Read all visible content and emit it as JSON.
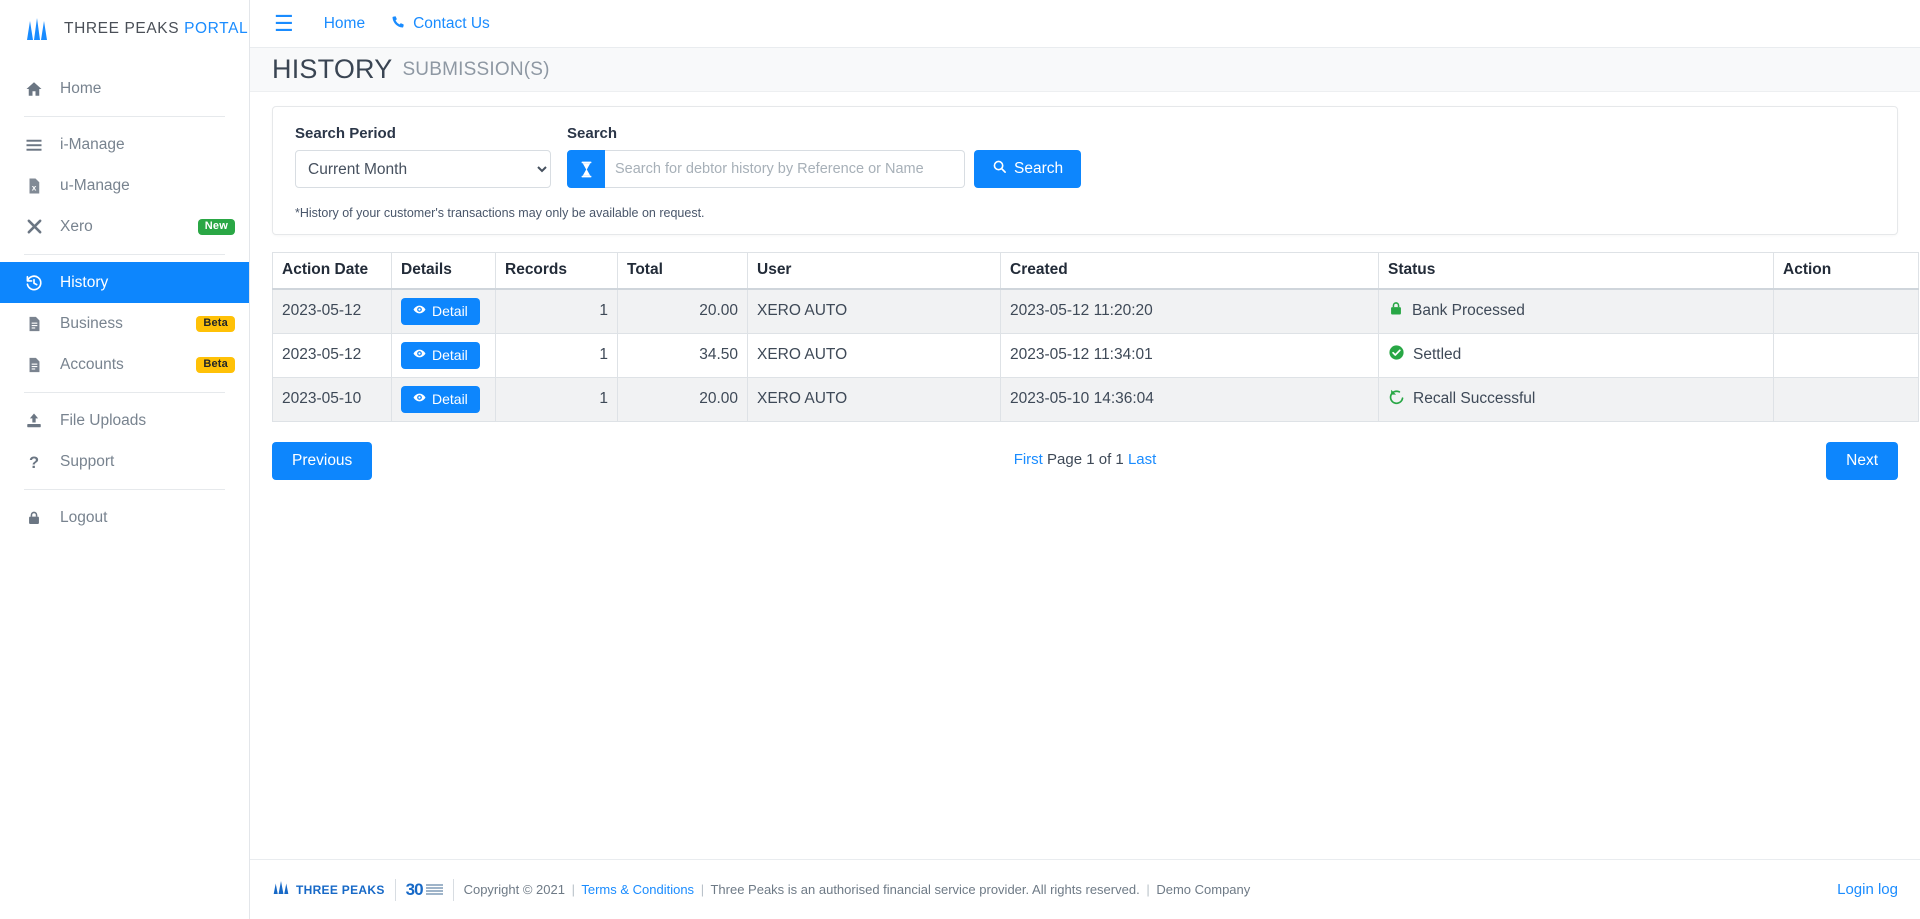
{
  "brand": {
    "name": "THREE PEAKS",
    "suffix": "PORTAL",
    "logo_icon": "three-peaks-logo",
    "accent_color": "#1a8cff"
  },
  "sidebar": {
    "items": [
      {
        "label": "Home",
        "icon": "home-icon",
        "badge": "",
        "active": false
      },
      {
        "label": "i-Manage",
        "icon": "bars-icon",
        "badge": "",
        "active": false
      },
      {
        "label": "u-Manage",
        "icon": "file-x-icon",
        "badge": "",
        "active": false
      },
      {
        "label": "Xero",
        "icon": "x-icon",
        "badge": "New",
        "active": false
      },
      {
        "label": "History",
        "icon": "history-icon",
        "badge": "",
        "active": true
      },
      {
        "label": "Business",
        "icon": "document-icon",
        "badge": "Beta",
        "active": false
      },
      {
        "label": "Accounts",
        "icon": "document-icon",
        "badge": "Beta",
        "active": false
      },
      {
        "label": "File Uploads",
        "icon": "upload-icon",
        "badge": "",
        "active": false
      },
      {
        "label": "Support",
        "icon": "question-icon",
        "badge": "",
        "active": false
      },
      {
        "label": "Logout",
        "icon": "lock-icon",
        "badge": "",
        "active": false
      }
    ]
  },
  "topbar": {
    "menu_icon": "hamburger-icon",
    "links": [
      {
        "label": "Home",
        "icon": ""
      },
      {
        "label": "Contact Us",
        "icon": "phone-icon"
      }
    ]
  },
  "page_header": {
    "title": "HISTORY",
    "subtitle": "SUBMISSION(S)"
  },
  "search_panel": {
    "period_label": "Search Period",
    "period_value": "Current Month",
    "period_options": [
      "Current Month"
    ],
    "search_label": "Search",
    "search_prefix_icon": "hourglass-icon",
    "search_value": "",
    "search_placeholder": "Search for debtor history by Reference or Name",
    "search_button_label": "Search",
    "search_button_icon": "magnifier-icon",
    "note": "*History of your customer's transactions may only be available on request."
  },
  "table": {
    "columns": [
      "Action Date",
      "Details",
      "Records",
      "Total",
      "User",
      "Created",
      "Status",
      "Action"
    ],
    "detail_button_label": "Detail",
    "detail_button_icon": "eye-icon",
    "rows": [
      {
        "action_date": "2023-05-12",
        "records": "1",
        "total": "20.00",
        "user": "XERO AUTO",
        "created": "2023-05-12 11:20:20",
        "status": "Bank Processed",
        "status_icon": "lock-icon",
        "status_color": "#28a745",
        "action": ""
      },
      {
        "action_date": "2023-05-12",
        "records": "1",
        "total": "34.50",
        "user": "XERO AUTO",
        "created": "2023-05-12 11:34:01",
        "status": "Settled",
        "status_icon": "check-circle-icon",
        "status_color": "#28a745",
        "action": ""
      },
      {
        "action_date": "2023-05-10",
        "records": "1",
        "total": "20.00",
        "user": "XERO AUTO",
        "created": "2023-05-10 14:36:04",
        "status": "Recall Successful",
        "status_icon": "undo-icon",
        "status_color": "#28a745",
        "action": ""
      }
    ]
  },
  "pagination": {
    "previous_label": "Previous",
    "next_label": "Next",
    "first_label": "First",
    "last_label": "Last",
    "page_text": "Page 1 of 1"
  },
  "footer": {
    "logo_text": "THREE PEAKS",
    "years_badge": "30",
    "copyright": "Copyright © 2021",
    "terms_label": "Terms & Conditions",
    "disclaimer": "Three Peaks is an authorised financial service provider. All rights reserved.",
    "company": "Demo Company",
    "login_log_label": "Login log"
  }
}
